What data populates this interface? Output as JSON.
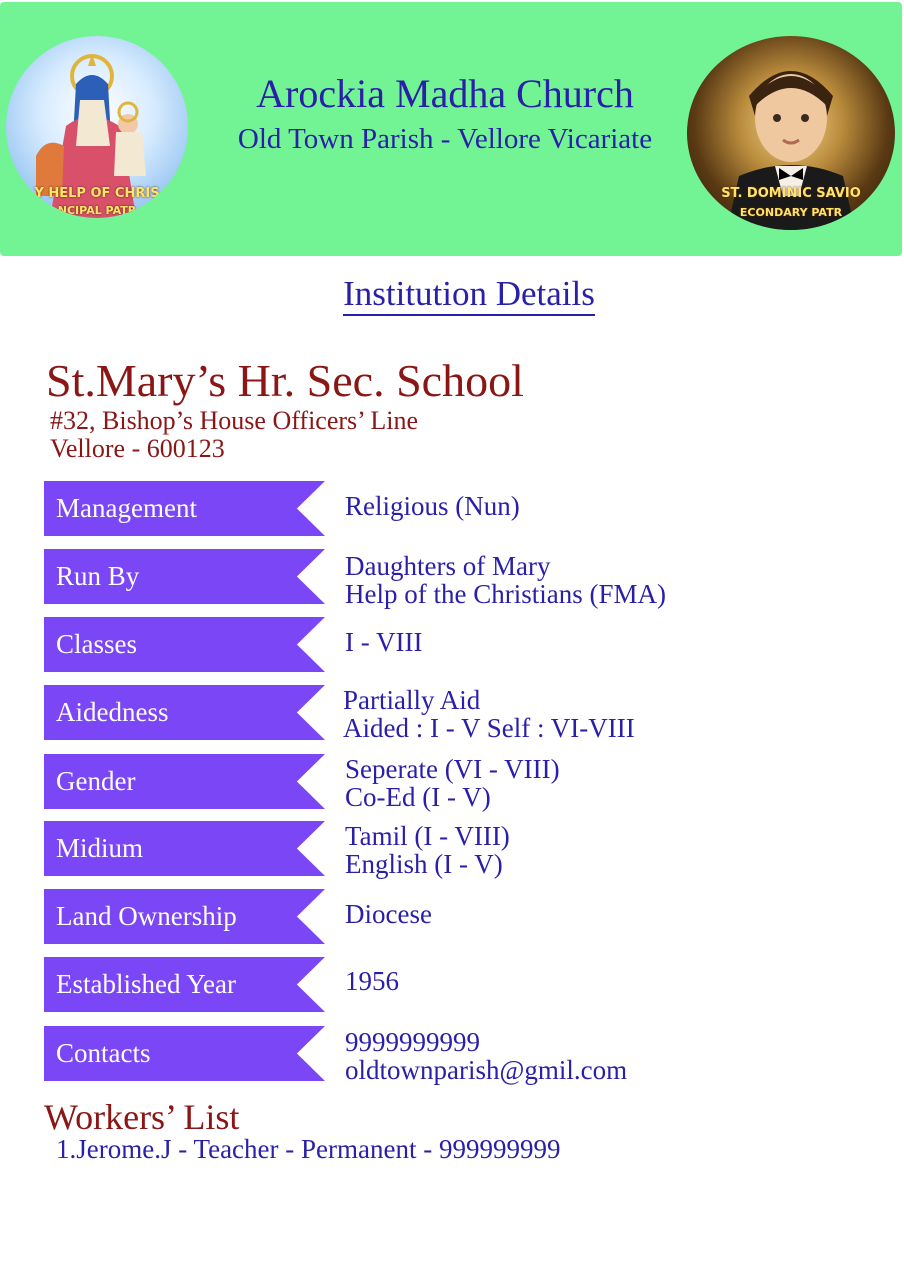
{
  "header": {
    "title": "Arockia Madha Church",
    "subtitle": "Old Town Parish - Vellore Vicariate",
    "left_patron": {
      "line1": "Y HELP OF CHRIS",
      "line2": "NCIPAL PATR"
    },
    "right_patron": {
      "line1": "ST. DOMINIC SAVIO",
      "line2": "ECONDARY PATR"
    }
  },
  "section_title": "Institution Details",
  "school": {
    "name": "St.Mary’s Hr. Sec. School",
    "address_line1": "#32, Bishop’s House Officers’ Line",
    "address_line2": "Vellore - 600123"
  },
  "details": [
    {
      "label": "Management",
      "value": [
        "Religious (Nun)"
      ]
    },
    {
      "label": "Run By",
      "value": [
        "Daughters of Mary",
        "Help of the Christians (FMA)"
      ]
    },
    {
      "label": "Classes",
      "value": [
        "I - VIII"
      ]
    },
    {
      "label": "Aidedness",
      "value": [
        "Partially Aid",
        "Aided : I - V Self : VI-VIII"
      ]
    },
    {
      "label": "Gender",
      "value": [
        "Seperate (VI - VIII)",
        "Co-Ed (I - V)"
      ]
    },
    {
      "label": "Midium",
      "value": [
        "Tamil (I - VIII)",
        "English (I - V)"
      ]
    },
    {
      "label": "Land Ownership",
      "value": [
        "Diocese"
      ]
    },
    {
      "label": "Established Year",
      "value": [
        "1956"
      ]
    },
    {
      "label": "Contacts",
      "value": [
        "9999999999",
        "oldtownparish@gmil.com"
      ]
    }
  ],
  "workers": {
    "title": "Workers’ List",
    "items": [
      "1.Jerome.J - Teacher - Permanent - 999999999"
    ]
  },
  "colors": {
    "banner": "#72f394",
    "label_box": "#7a46f6",
    "heading_blue": "#2a1fa8",
    "school_red": "#8a1616"
  }
}
